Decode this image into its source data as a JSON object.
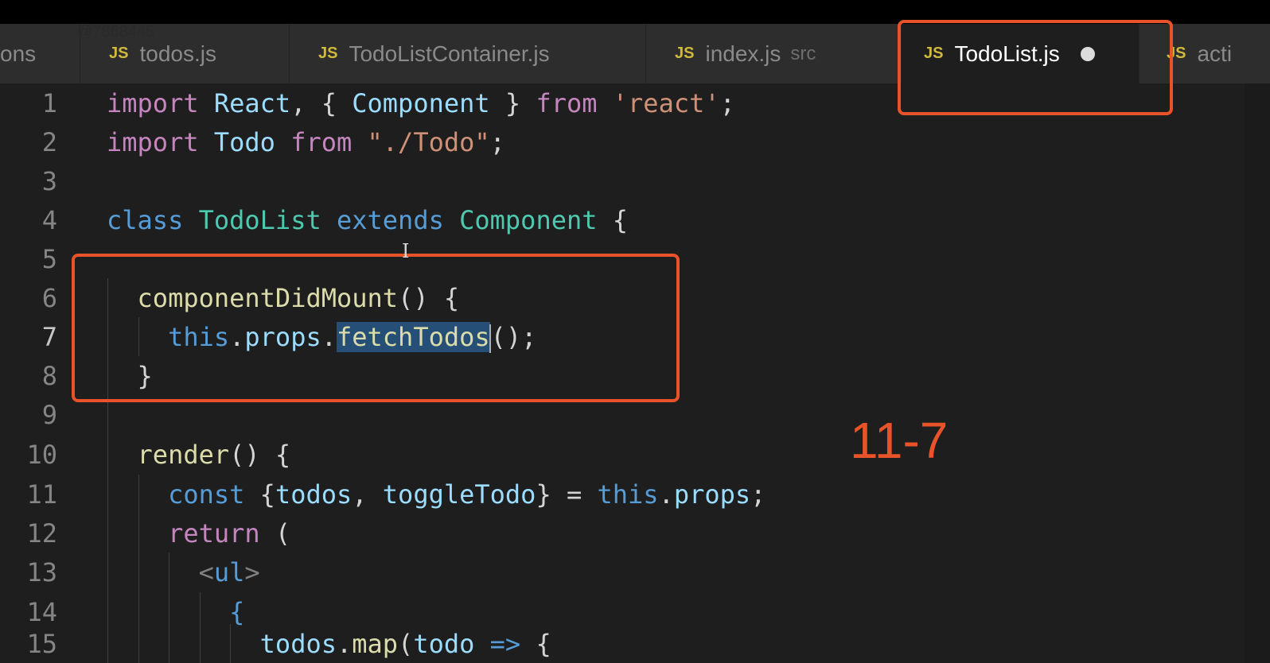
{
  "editor": {
    "tabs": [
      {
        "name": "partial-left-tab",
        "label": "ons",
        "desc": "",
        "active": false,
        "modified": false,
        "icon": "",
        "left": 0,
        "width": 100
      },
      {
        "name": "tab-todos-js",
        "label": "todos.js",
        "desc": "",
        "active": false,
        "modified": false,
        "icon": "JS"
      },
      {
        "name": "tab-todolistcontainer-js",
        "label": "TodoListContainer.js",
        "desc": "",
        "active": false,
        "modified": false,
        "icon": "JS"
      },
      {
        "name": "tab-index-js",
        "label": "index.js",
        "desc": "src",
        "active": false,
        "modified": false,
        "icon": "JS"
      },
      {
        "name": "tab-todolist-js",
        "label": "TodoList.js",
        "desc": "",
        "active": true,
        "modified": true,
        "icon": "JS"
      },
      {
        "name": "partial-right-tab",
        "label": "acti",
        "desc": "",
        "active": false,
        "modified": false,
        "icon": "JS"
      }
    ],
    "watermark": "@7868445",
    "current_line": 7,
    "lines": [
      {
        "n": "1",
        "tokens": [
          {
            "t": "import",
            "c": "kw"
          },
          {
            "t": " "
          },
          {
            "t": "React",
            "c": "var"
          },
          {
            "t": ", { "
          },
          {
            "t": "Component",
            "c": "var"
          },
          {
            "t": " } "
          },
          {
            "t": "from",
            "c": "kw"
          },
          {
            "t": " "
          },
          {
            "t": "'react'",
            "c": "str"
          },
          {
            "t": ";"
          }
        ]
      },
      {
        "n": "2",
        "tokens": [
          {
            "t": "import",
            "c": "kw"
          },
          {
            "t": " "
          },
          {
            "t": "Todo",
            "c": "var"
          },
          {
            "t": " "
          },
          {
            "t": "from",
            "c": "kw"
          },
          {
            "t": " "
          },
          {
            "t": "\"./Todo\"",
            "c": "str"
          },
          {
            "t": ";"
          }
        ]
      },
      {
        "n": "3",
        "tokens": []
      },
      {
        "n": "4",
        "tokens": [
          {
            "t": "class",
            "c": "kb"
          },
          {
            "t": " "
          },
          {
            "t": "TodoList",
            "c": "cls"
          },
          {
            "t": " "
          },
          {
            "t": "extends",
            "c": "kb"
          },
          {
            "t": " "
          },
          {
            "t": "Component",
            "c": "cls"
          },
          {
            "t": " {"
          }
        ]
      },
      {
        "n": "5",
        "tokens": []
      },
      {
        "n": "6",
        "tokens": [
          {
            "t": "  "
          },
          {
            "t": "componentDidMount",
            "c": "fn"
          },
          {
            "t": "() {"
          }
        ]
      },
      {
        "n": "7",
        "tokens": [
          {
            "t": "    "
          },
          {
            "t": "this",
            "c": "kb"
          },
          {
            "t": "."
          },
          {
            "t": "props",
            "c": "var"
          },
          {
            "t": "."
          },
          {
            "t": "fetchTodos",
            "c": "fn sel",
            "caret": true
          },
          {
            "t": "();"
          }
        ]
      },
      {
        "n": "8",
        "tokens": [
          {
            "t": "  }"
          }
        ]
      },
      {
        "n": "9",
        "tokens": []
      },
      {
        "n": "10",
        "tokens": [
          {
            "t": "  "
          },
          {
            "t": "render",
            "c": "fn"
          },
          {
            "t": "() {"
          }
        ]
      },
      {
        "n": "11",
        "tokens": [
          {
            "t": "    "
          },
          {
            "t": "const",
            "c": "kb"
          },
          {
            "t": " {"
          },
          {
            "t": "todos",
            "c": "var"
          },
          {
            "t": ", "
          },
          {
            "t": "toggleTodo",
            "c": "var"
          },
          {
            "t": "} = "
          },
          {
            "t": "this",
            "c": "kb"
          },
          {
            "t": "."
          },
          {
            "t": "props",
            "c": "var"
          },
          {
            "t": ";"
          }
        ]
      },
      {
        "n": "12",
        "tokens": [
          {
            "t": "    "
          },
          {
            "t": "return",
            "c": "kw"
          },
          {
            "t": " ("
          }
        ]
      },
      {
        "n": "13",
        "tokens": [
          {
            "t": "      "
          },
          {
            "t": "<",
            "c": "dim"
          },
          {
            "t": "ul",
            "c": "kb"
          },
          {
            "t": ">",
            "c": "dim"
          }
        ]
      },
      {
        "n": "14",
        "tokens": [
          {
            "t": "        "
          },
          {
            "t": "{",
            "c": "kb"
          }
        ]
      },
      {
        "n": "15",
        "tokens": [
          {
            "t": "          "
          },
          {
            "t": "todos",
            "c": "var"
          },
          {
            "t": "."
          },
          {
            "t": "map",
            "c": "fn"
          },
          {
            "t": "("
          },
          {
            "t": "todo",
            "c": "var"
          },
          {
            "t": " "
          },
          {
            "t": "=>",
            "c": "kb"
          },
          {
            "t": " {"
          }
        ]
      }
    ]
  },
  "annotation": {
    "label": "11-7",
    "color": "#e8532a"
  },
  "colors": {
    "background": "#1e1e1e",
    "tab_bar": "#252526",
    "annotation": "#e8532a",
    "js_icon": "#d1b93b",
    "selection": "#264f78"
  }
}
